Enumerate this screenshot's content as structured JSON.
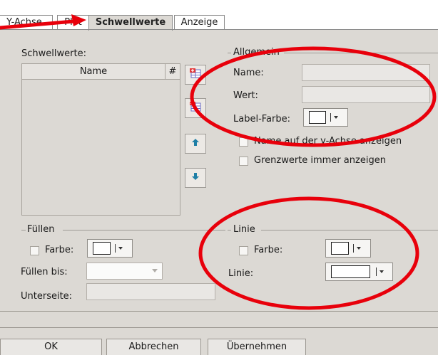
{
  "tabs": [
    {
      "label": "Y-Achse",
      "active": false
    },
    {
      "label": "Plot",
      "active": false
    },
    {
      "label": "Schwellwerte",
      "active": true
    },
    {
      "label": "Anzeige",
      "active": false
    }
  ],
  "thresholds": {
    "label": "Schwellwerte:",
    "columns": {
      "name": "Name",
      "number": "#"
    },
    "items": []
  },
  "toolbar_icons": [
    "add-row-icon",
    "delete-row-icon",
    "arrow-up-icon",
    "arrow-down-icon"
  ],
  "general": {
    "title": "Allgemein",
    "name_label": "Name:",
    "name_value": "",
    "value_label": "Wert:",
    "value_value": "",
    "label_color_label": "Label-Farbe:",
    "label_color": "#ffffff",
    "show_name_on_axis": "Name auf der y-Achse anzeigen",
    "show_name_on_axis_checked": false,
    "always_show_limits": "Grenzwerte immer anzeigen",
    "always_show_limits_checked": false
  },
  "fill": {
    "title": "Füllen",
    "color_label": "Farbe:",
    "color_checked": false,
    "color": "#ffffff",
    "fill_to_label": "Füllen bis:",
    "fill_to_value": "",
    "bottom_label": "Unterseite:",
    "bottom_value": ""
  },
  "line": {
    "title": "Linie",
    "color_label": "Farbe:",
    "color_checked": false,
    "color": "#ffffff",
    "line_label": "Linie:",
    "line_color": "#ffffff"
  },
  "buttons": {
    "ok": "OK",
    "cancel": "Abbrechen",
    "apply": "Übernehmen"
  },
  "annotation_color": "#e8000b"
}
